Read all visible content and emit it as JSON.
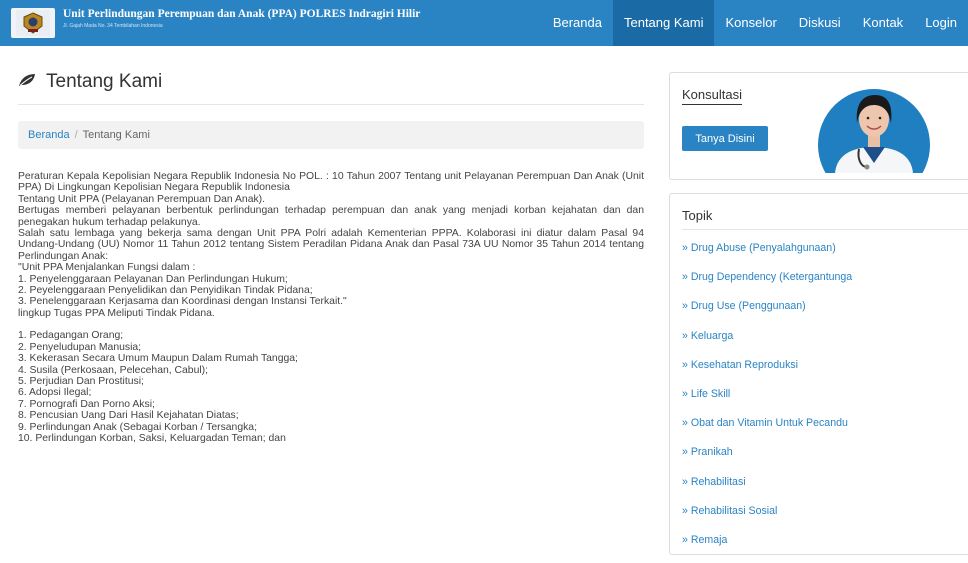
{
  "brand": {
    "title": "Unit Perlindungan Perempuan dan Anak (PPA) POLRES Indragiri Hilir",
    "subtitle": "Jl. Gajah Mada No. 34 Tembilahan Indonesia"
  },
  "nav": [
    {
      "label": "Beranda",
      "active": false
    },
    {
      "label": "Tentang Kami",
      "active": true
    },
    {
      "label": "Konselor",
      "active": false
    },
    {
      "label": "Diskusi",
      "active": false
    },
    {
      "label": "Kontak",
      "active": false
    },
    {
      "label": "Login",
      "active": false
    }
  ],
  "page": {
    "title": "Tentang Kami",
    "title_icon": "leaf-icon",
    "breadcrumb": {
      "home": "Beranda",
      "current": "Tentang Kami"
    }
  },
  "content": {
    "intro": "Peraturan Kepala Kepolisian Negara Republik Indonesia No POL. : 10 Tahun 2007 Tentang unit Pelayanan Perempuan Dan Anak (Unit PPA) Di Lingkungan Kepolisian Negara Republik Indonesia",
    "unit_title": "Tentang Unit PPA (Pelayanan Perempuan Dan Anak).",
    "unit_desc": "Bertugas memberi pelayanan berbentuk perlindungan terhadap perempuan dan anak yang menjadi korban kejahatan dan dan penegakan hukum terhadap pelakunya.",
    "collab": "Salah satu lembaga yang bekerja sama dengan Unit PPA Polri adalah Kementerian PPPA. Kolaborasi ini diatur dalam Pasal 94 Undang-Undang (UU) Nomor 11 Tahun 2012 tentang Sistem Peradilan Pidana Anak dan Pasal 73A UU Nomor 35 Tahun 2014 tentang Perlindungan Anak:",
    "functions_head": "\"Unit PPA Menjalankan Fungsi dalam :",
    "functions": [
      "1. Penyelenggaraan Pelayanan Dan Perlindungan Hukum;",
      "2. Peyelenggaraan Penyelidikan dan Penyidikan Tindak Pidana;",
      "3. Penelenggaraan Kerjasama dan Koordinasi dengan Instansi Terkait.\""
    ],
    "scope_head": "lingkup Tugas PPA Meliputi Tindak Pidana.",
    "tasks": [
      "1. Pedagangan Orang;",
      "2. Penyeludupan Manusia;",
      "3. Kekerasan Secara Umum Maupun Dalam Rumah Tangga;",
      "4. Susila (Perkosaan, Pelecehan, Cabul);",
      "5. Perjudian Dan Prostitusi;",
      "6. Adopsi Ilegal;",
      "7. Pornografi Dan Porno Aksi;",
      "8. Pencusian Uang Dari Hasil Kejahatan Diatas;",
      "9. Perlindungan Anak (Sebagai Korban / Tersangka;",
      "10. Perlindungan Korban, Saksi, Keluargadan Teman; dan"
    ]
  },
  "sidebar": {
    "konsultasi": {
      "title": "Konsultasi",
      "button": "Tanya Disini"
    },
    "topik": {
      "title": "Topik",
      "items": [
        "» Drug Abuse (Penyalahgunaan)",
        "» Drug Dependency (Ketergantunga",
        "» Drug Use (Penggunaan)",
        "» Keluarga",
        "» Kesehatan Reproduksi",
        "» Life Skill",
        "» Obat dan Vitamin Untuk Pecandu",
        "» Pranikah",
        "» Rehabilitasi",
        "» Rehabilitasi Sosial",
        "» Remaja"
      ]
    }
  },
  "colors": {
    "brand": "#2a84c4",
    "nav_active": "#1a6aa5",
    "breadcrumb_bg": "#f2f2f2"
  }
}
